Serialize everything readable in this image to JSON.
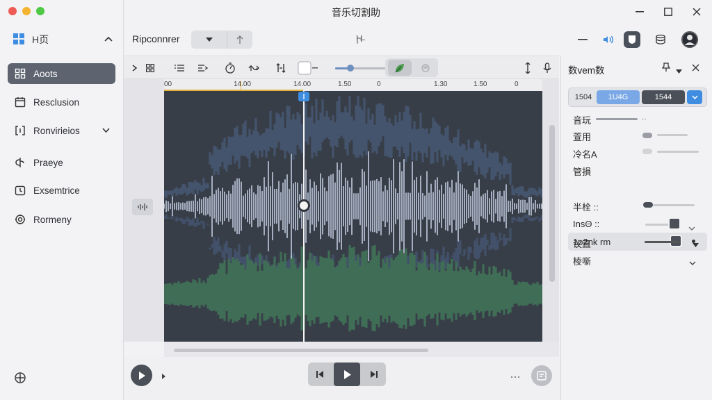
{
  "window": {
    "title": "音乐切割助"
  },
  "sidebar": {
    "header": {
      "label": "H页"
    },
    "items": [
      {
        "label": "Aoots",
        "icon": "grid-icon",
        "active": true
      },
      {
        "label": "Resclusion",
        "icon": "calendar-icon"
      },
      {
        "label": "Ronvirieios",
        "icon": "bracket-icon"
      },
      {
        "label": "Praeye",
        "icon": "layers-icon"
      },
      {
        "label": "Exsemtrice",
        "icon": "clock-icon"
      },
      {
        "label": "Rormeny",
        "icon": "settings-icon"
      }
    ]
  },
  "toolbar": {
    "project_label": "Ripconnrer",
    "center_glyph": "Ḩ̶",
    "right_icons": [
      "minus-icon",
      "audio-icon",
      "shield-icon",
      "database-icon",
      "avatar"
    ]
  },
  "timeline": {
    "ticks": [
      "00",
      "14.00",
      "14.00",
      "1.50",
      "0",
      "1.30",
      "1.50",
      "0"
    ],
    "zoom_value": 0.3
  },
  "inspector": {
    "title": "数vem数",
    "segment": {
      "left": "1504",
      "mid": "1U4G",
      "right": "1544"
    },
    "rows": {
      "r1": "音玩",
      "r2": "萱用",
      "r3": "冷名A",
      "r4": "管損",
      "r5": "1o2nk rm",
      "r6": "半栓 ::",
      "r7": "InsΘ ::",
      "r8": "议直",
      "r9": "棱噺"
    }
  },
  "colors": {
    "accent": "#3f8de0",
    "waveform_upper": "#44546d",
    "waveform_core": "#c8d3e6",
    "waveform_lower": "#3f6d55",
    "waveform_bg": "#383e48",
    "marker": "#e3b23c"
  }
}
